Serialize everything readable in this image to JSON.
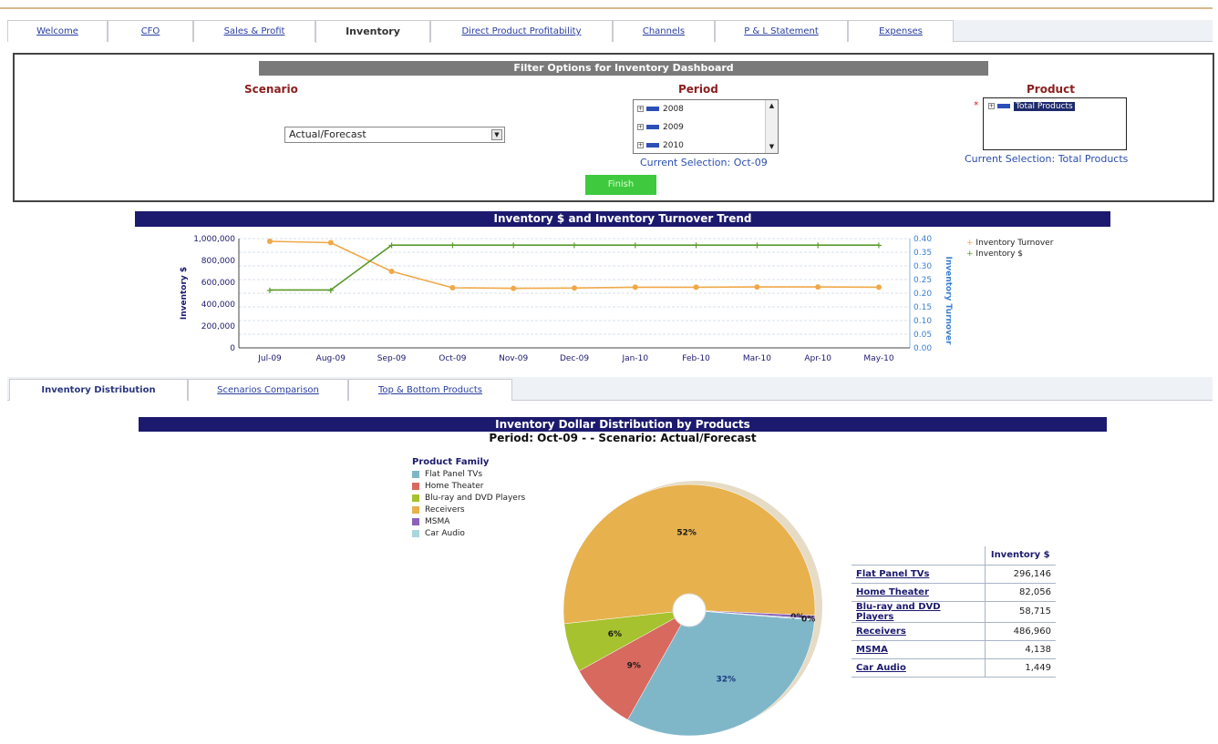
{
  "top_tabs": [
    {
      "label": "Welcome",
      "active": false
    },
    {
      "label": "CFO",
      "active": false
    },
    {
      "label": "Sales & Profit",
      "active": false
    },
    {
      "label": "Inventory",
      "active": true
    },
    {
      "label": "Direct Product Profitability",
      "active": false
    },
    {
      "label": "Channels",
      "active": false
    },
    {
      "label": "P & L Statement",
      "active": false
    },
    {
      "label": "Expenses",
      "active": false
    }
  ],
  "filter": {
    "title": "Filter Options for Inventory Dashboard",
    "scenario_label": "Scenario",
    "scenario_value": "Actual/Forecast",
    "period_label": "Period",
    "period_items": [
      "2008",
      "2009",
      "2010"
    ],
    "period_current": "Current Selection: Oct-09",
    "product_label": "Product",
    "product_item": "Total Products",
    "product_current": "Current Selection: Total Products",
    "finish_label": "Finish"
  },
  "trend_title": "Inventory $ and Inventory Turnover Trend",
  "sub_tabs": [
    {
      "label": "Inventory Distribution",
      "active": true
    },
    {
      "label": "Scenarios Comparison",
      "active": false
    },
    {
      "label": "Top & Bottom Products",
      "active": false
    }
  ],
  "distribution": {
    "title": "Inventory Dollar Distribution by Products",
    "subtitle": "Period: Oct-09 - - Scenario: Actual/Forecast",
    "legend_title": "Product Family",
    "table_header": "Inventory $",
    "rows": [
      {
        "name": "Flat Panel TVs",
        "value": "296,146"
      },
      {
        "name": "Home Theater",
        "value": "82,056"
      },
      {
        "name": "Blu-ray and DVD Players",
        "value": "58,715"
      },
      {
        "name": "Receivers",
        "value": "486,960"
      },
      {
        "name": "MSMA",
        "value": "4,138"
      },
      {
        "name": "Car Audio",
        "value": "1,449"
      }
    ]
  },
  "chart_data": [
    {
      "type": "line",
      "title": "Inventory $ and Inventory Turnover Trend",
      "x": [
        "Jul-09",
        "Aug-09",
        "Sep-09",
        "Oct-09",
        "Nov-09",
        "Dec-09",
        "Jan-10",
        "Feb-10",
        "Mar-10",
        "Apr-10",
        "May-10"
      ],
      "ylabel": "Inventory $",
      "ylim": [
        0,
        1000000
      ],
      "yticks": [
        "0",
        "200,000",
        "400,000",
        "600,000",
        "800,000",
        "1,000,000"
      ],
      "y2label": "Inventory Turnover",
      "y2lim": [
        0,
        0.4
      ],
      "y2ticks": [
        "0.00",
        "0.05",
        "0.10",
        "0.15",
        "0.20",
        "0.25",
        "0.30",
        "0.35",
        "0.40"
      ],
      "grid": true,
      "legend": "right",
      "series": [
        {
          "name": "Inventory Turnover",
          "axis": "right",
          "color": "#f0a848",
          "values": [
            0.39,
            0.385,
            0.28,
            0.22,
            0.218,
            0.219,
            0.222,
            0.222,
            0.223,
            0.223,
            0.222
          ]
        },
        {
          "name": "Inventory $",
          "axis": "left",
          "color": "#5a9a2a",
          "values": [
            530000,
            530000,
            940000,
            940000,
            940000,
            940000,
            940000,
            940000,
            940000,
            940000,
            940000
          ]
        }
      ]
    },
    {
      "type": "pie",
      "title": "Inventory Dollar Distribution by Products",
      "legend_title": "Product Family",
      "legend": "top-left",
      "categories": [
        "Flat Panel TVs",
        "Home Theater",
        "Blu-ray and DVD Players",
        "Receivers",
        "MSMA",
        "Car Audio"
      ],
      "values": [
        296146,
        82056,
        58715,
        486960,
        4138,
        1449
      ],
      "labels": [
        "32%",
        "9%",
        "6%",
        "52%",
        "0%",
        "0%"
      ],
      "colors": [
        "#7fb7c9",
        "#d8695f",
        "#a6c22e",
        "#e7b14d",
        "#8a63b8",
        "#a9d6dd"
      ]
    }
  ]
}
